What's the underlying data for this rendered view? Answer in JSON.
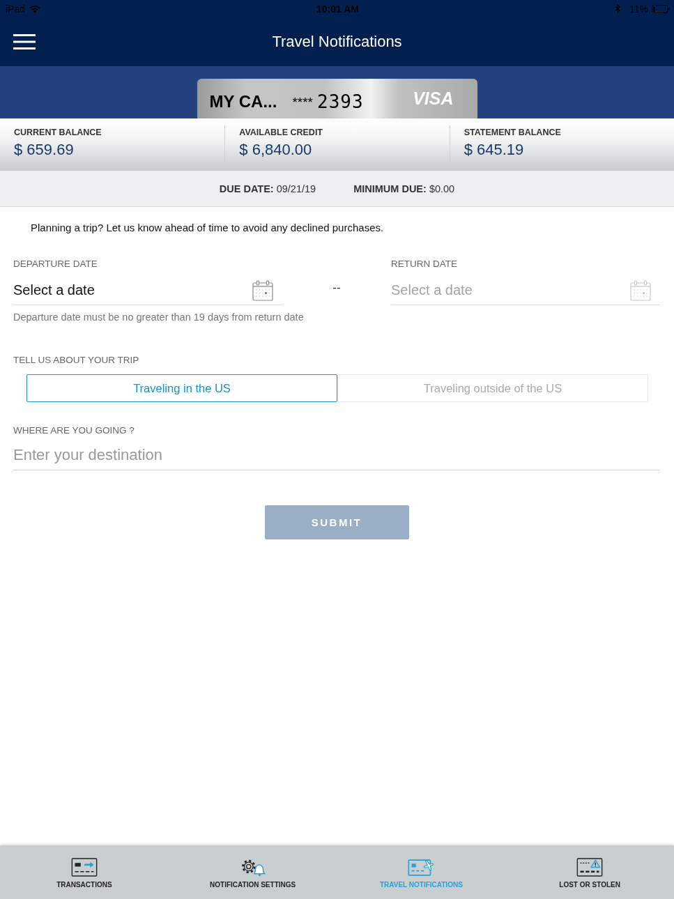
{
  "status_bar": {
    "device": "iPad",
    "time": "10:01 AM",
    "battery": "11%"
  },
  "header": {
    "title": "Travel Notifications"
  },
  "card": {
    "name": "MY CA...",
    "masked": "****",
    "last_digits": "2393",
    "network": "VISA"
  },
  "balances": [
    {
      "label": "CURRENT BALANCE",
      "amount": "$ 659.69"
    },
    {
      "label": "AVAILABLE CREDIT",
      "amount": "$ 6,840.00"
    },
    {
      "label": "STATEMENT BALANCE",
      "amount": "$ 645.19"
    }
  ],
  "due": [
    {
      "label": "DUE DATE:",
      "value": "09/21/19"
    },
    {
      "label": "MINIMUM DUE:",
      "value": "$0.00"
    }
  ],
  "intro": "Planning a trip? Let us know ahead of time to avoid any declined purchases.",
  "dates": {
    "fields": [
      {
        "label": "DEPARTURE DATE",
        "placeholder": "Select a date",
        "disabled": false
      },
      {
        "label": "RETURN DATE",
        "placeholder": "Select a date",
        "disabled": true
      }
    ],
    "separator": "--",
    "hint": "Departure date must be no greater than 19 days from return date"
  },
  "trip": {
    "label": "TELL US ABOUT YOUR TRIP",
    "options": [
      {
        "label": "Traveling in the US",
        "selected": true
      },
      {
        "label": "Traveling outside of the US",
        "selected": false
      }
    ]
  },
  "destination": {
    "label": "WHERE ARE YOU GOING ?",
    "placeholder": "Enter your destination"
  },
  "submit": {
    "label": "SUBMIT",
    "disabled": true
  },
  "tab_bar": [
    {
      "label": "TRANSACTIONS",
      "kind": "transactions",
      "selected": false
    },
    {
      "label": "NOTIFICATION SETTINGS",
      "kind": "settings",
      "selected": false
    },
    {
      "label": "TRAVEL NOTIFICATIONS",
      "kind": "travel",
      "selected": true
    },
    {
      "label": "LOST OR STOLEN",
      "kind": "lost",
      "selected": false
    }
  ]
}
